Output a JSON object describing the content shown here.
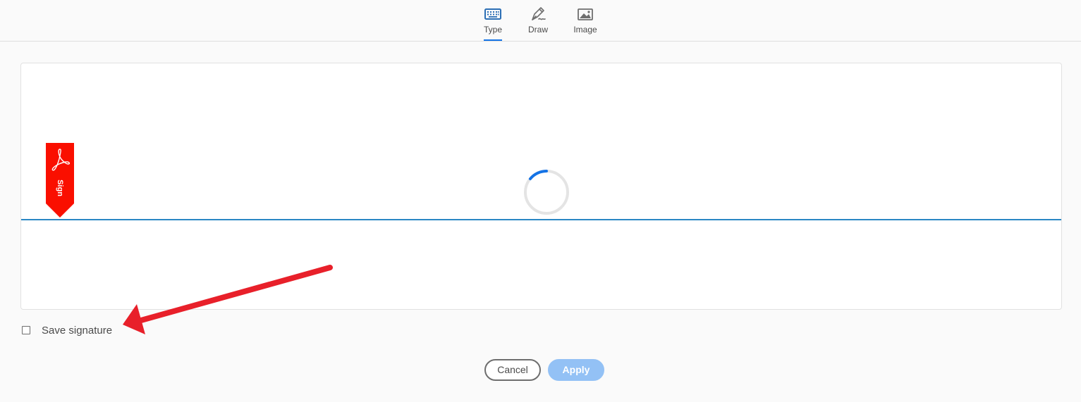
{
  "tabs": [
    {
      "label": "Type",
      "icon": "keyboard-icon",
      "active": true
    },
    {
      "label": "Draw",
      "icon": "pen-icon",
      "active": false
    },
    {
      "label": "Image",
      "icon": "image-icon",
      "active": false
    }
  ],
  "signature_area": {
    "flag_text": "Sign",
    "flag_icon": "acrobat-logo-icon",
    "loading": true
  },
  "save_signature": {
    "label": "Save signature",
    "checked": false
  },
  "buttons": {
    "cancel": "Cancel",
    "apply": "Apply"
  },
  "colors": {
    "accent": "#1473e6",
    "baseline": "#2a87c4",
    "flag": "#fa0f00",
    "apply_disabled": "#93c1f5",
    "annotation_arrow": "#e8202a"
  }
}
